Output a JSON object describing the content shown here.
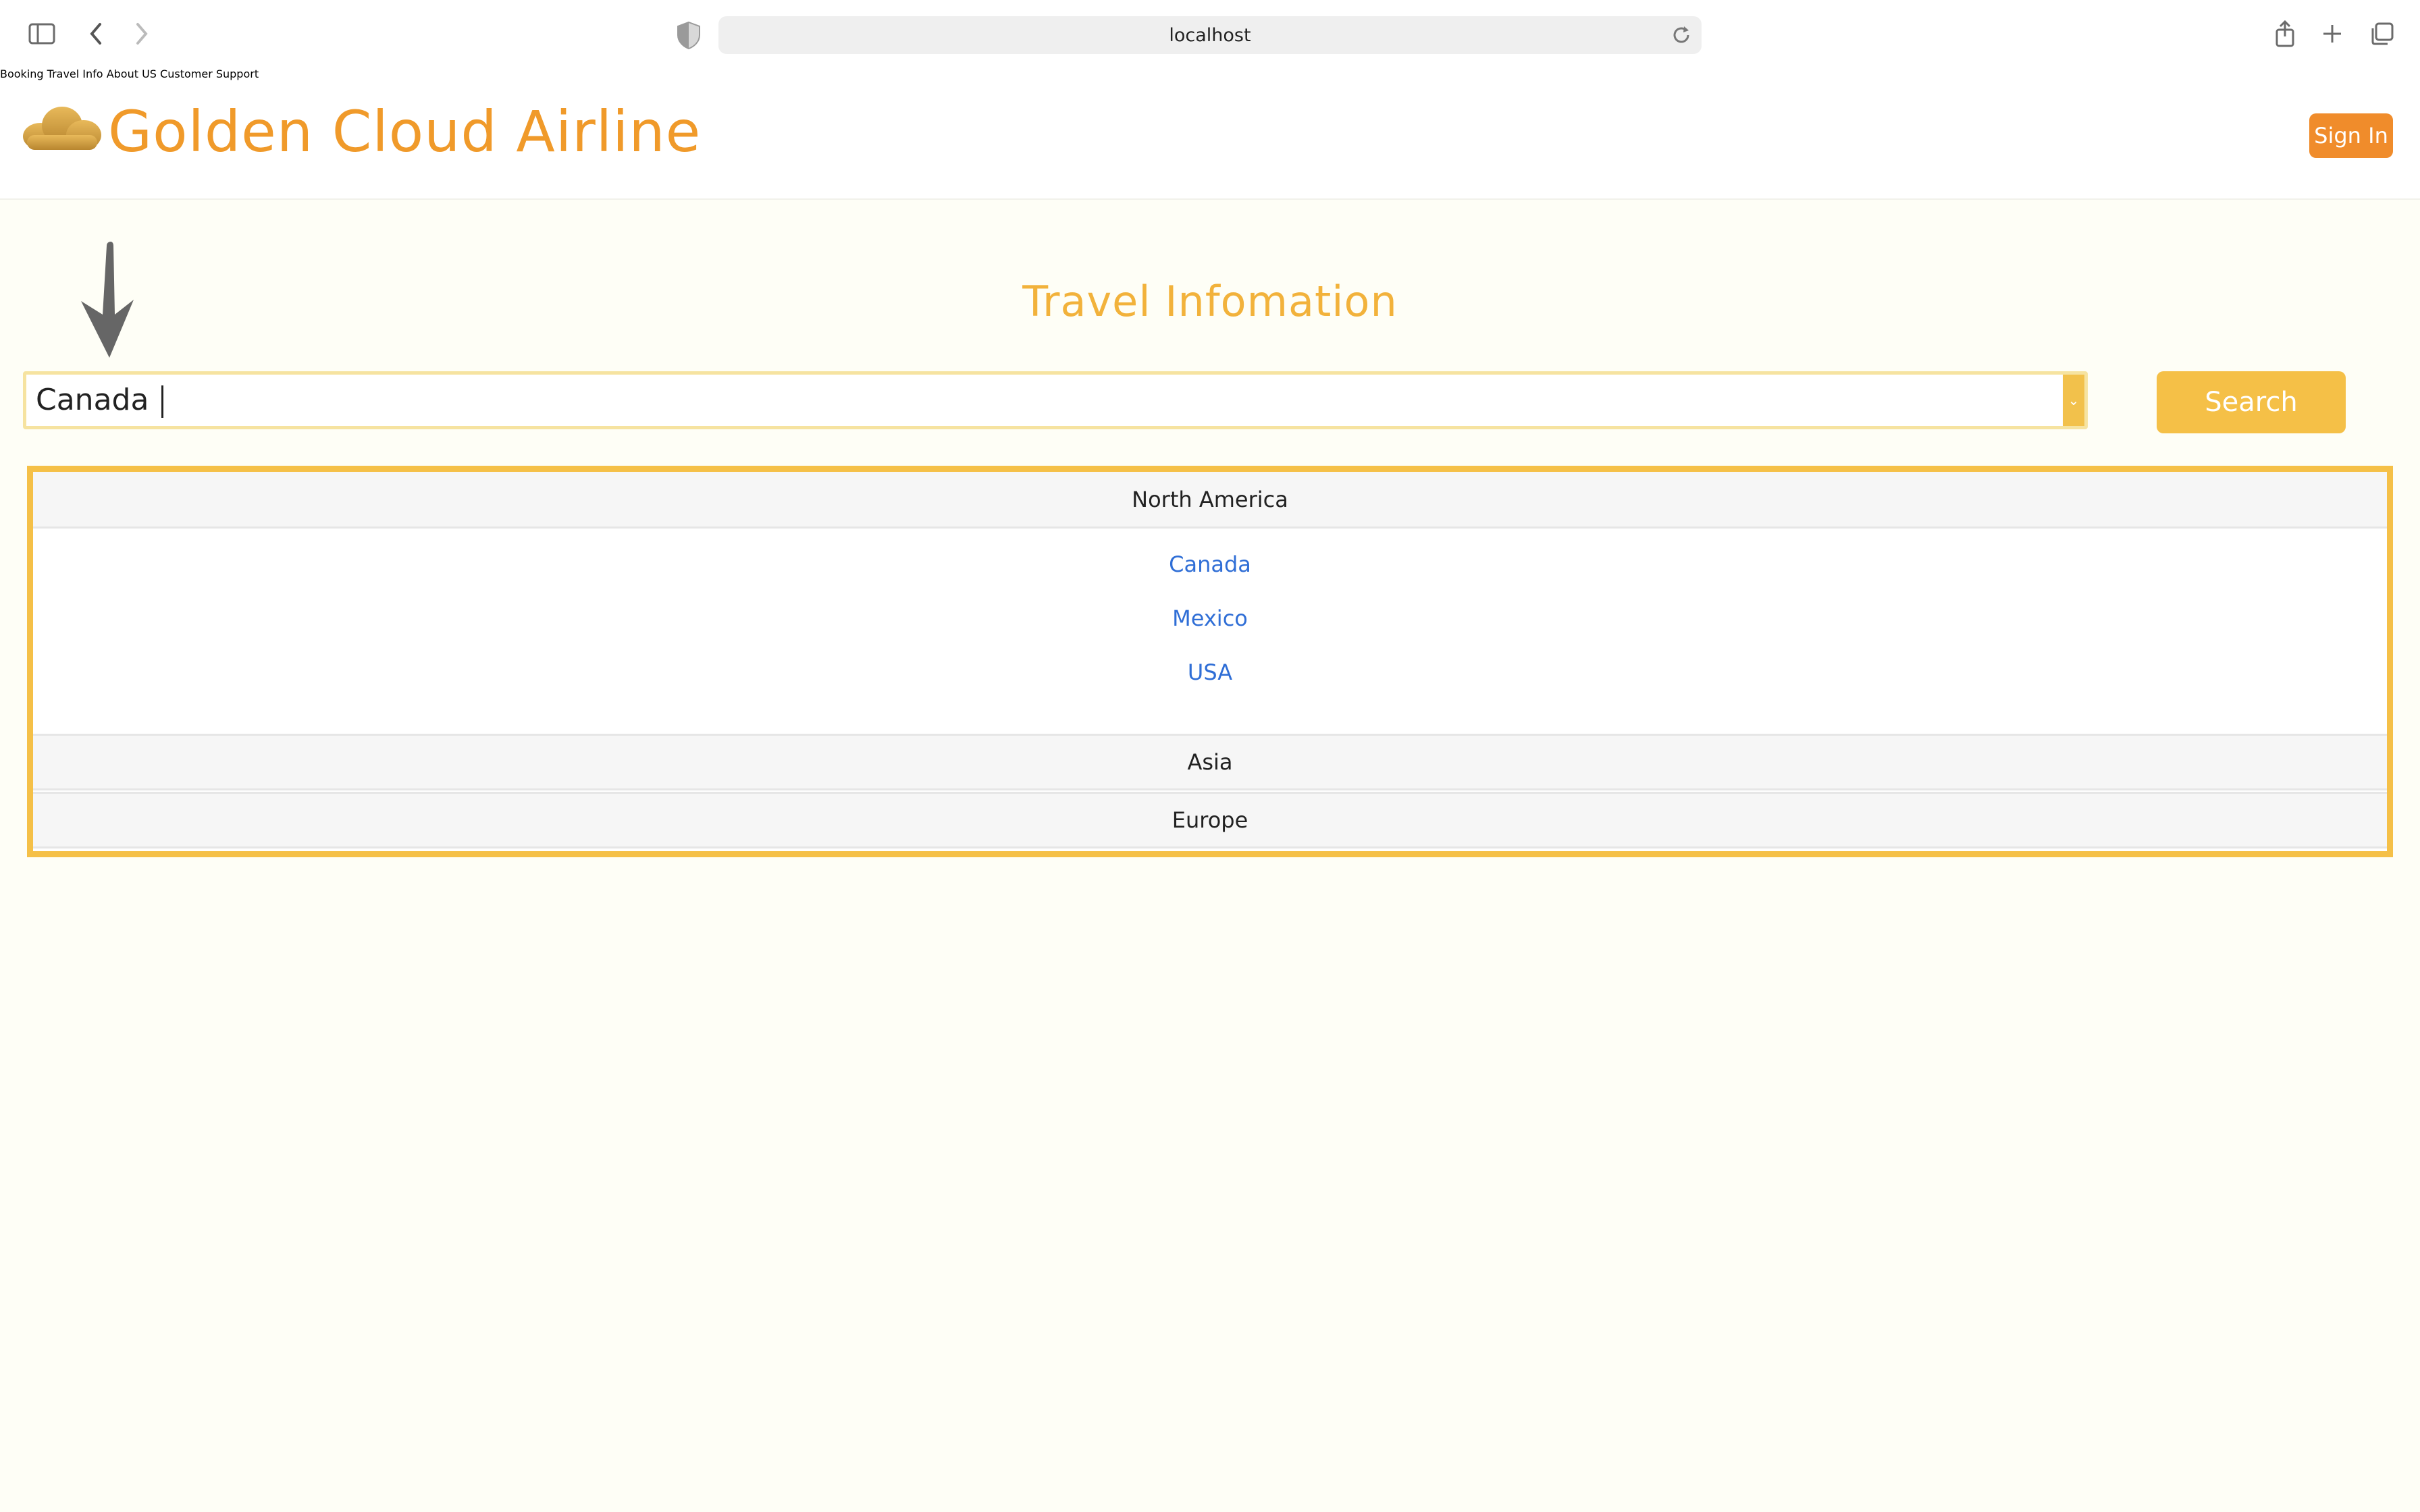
{
  "browser": {
    "url": "localhost"
  },
  "header": {
    "brand": "Golden Cloud Airline",
    "nav": [
      "Booking",
      "Travel Info",
      "About US",
      "Customer Support"
    ],
    "sign_in": "Sign In"
  },
  "main": {
    "title": "Travel Infomation",
    "search_value": "Canada",
    "search_button": "Search",
    "regions": [
      {
        "name": "North America",
        "countries": [
          "Canada",
          "Mexico",
          "USA"
        ],
        "expanded": true
      },
      {
        "name": "Asia",
        "expanded": false
      },
      {
        "name": "Europe",
        "expanded": false
      }
    ]
  },
  "colors": {
    "brand": "#f09a2a",
    "accent": "#f5c047",
    "link": "#2f6ed6"
  }
}
